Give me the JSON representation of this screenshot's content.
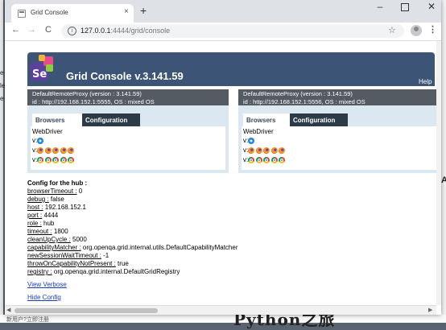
{
  "browser": {
    "tab_title": "Grid Console",
    "tab_close": "×",
    "new_tab": "+",
    "window_min": "–",
    "window_close": "✕",
    "back": "←",
    "forward": "→",
    "reload": "C",
    "info_icon": "i",
    "url_host": "127.0.0.1",
    "url_path": ":4444/grid/console",
    "star": "☆",
    "menu": "⋮"
  },
  "page": {
    "title": "Grid Console v.3.141.59",
    "help": "Help"
  },
  "proxies": [
    {
      "name": "DefaultRemoteProxy (version : 3.141.59)",
      "id": "id : http://192.168.152.1:5555, OS : mixed OS",
      "tabs": [
        "Browsers",
        "Configuration"
      ],
      "protocol": "WebDriver",
      "rows": [
        {
          "label": "v:",
          "icons": [
            "ie"
          ]
        },
        {
          "label": "v:",
          "icons": [
            "ff",
            "ff",
            "ff",
            "ff",
            "ff"
          ]
        },
        {
          "label": "v:",
          "icons": [
            "ch",
            "ch",
            "ch",
            "ch",
            "ch"
          ]
        }
      ]
    },
    {
      "name": "DefaultRemoteProxy (version : 3.141.59)",
      "id": "id : http://192.168.152.1:5556, OS : mixed OS",
      "tabs": [
        "Browsers",
        "Configuration"
      ],
      "protocol": "WebDriver",
      "rows": [
        {
          "label": "v:",
          "icons": [
            "ie"
          ]
        },
        {
          "label": "v:",
          "icons": [
            "ff",
            "ff",
            "ff",
            "ff",
            "ff"
          ]
        },
        {
          "label": "v:",
          "icons": [
            "ch",
            "ch",
            "ch",
            "ch",
            "ch"
          ]
        }
      ]
    }
  ],
  "hub_config": {
    "title": "Config for the hub :",
    "entries": [
      {
        "key": "browserTimeout :",
        "value": " 0"
      },
      {
        "key": "debug :",
        "value": " false"
      },
      {
        "key": "host :",
        "value": " 192.168.152.1"
      },
      {
        "key": "port :",
        "value": " 4444"
      },
      {
        "key": "role :",
        "value": " hub"
      },
      {
        "key": "timeout :",
        "value": " 1800"
      },
      {
        "key": "cleanUpCycle :",
        "value": " 5000"
      },
      {
        "key": "capabilityMatcher :",
        "value": " org.openqa.grid.internal.utils.DefaultCapabilityMatcher"
      },
      {
        "key": "newSessionWaitTimeout :",
        "value": " -1"
      },
      {
        "key": "throwOnCapabilityNotPresent :",
        "value": " true"
      },
      {
        "key": "registry :",
        "value": " org.openqa.grid.internal.DefaultGridRegistry"
      }
    ]
  },
  "links": {
    "view_verbose": "View Verbose",
    "hide_config": "Hide Config"
  },
  "background": {
    "left_chars": [
      "e",
      "le",
      "e"
    ],
    "right_char": "A",
    "bottom_text": "新用户?立即注册",
    "bottom_big": "Python之旅"
  }
}
